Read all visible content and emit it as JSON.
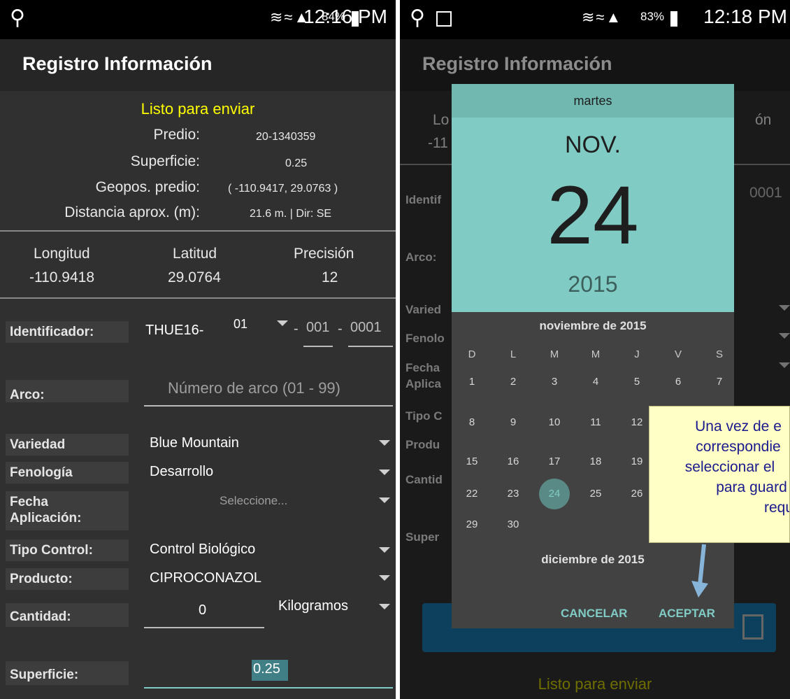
{
  "left": {
    "status": {
      "battery": "84%",
      "time": "12:16 PM"
    },
    "title": "Registro Información",
    "summary": {
      "status_text": "Listo para enviar",
      "rows": [
        {
          "label": "Predio:",
          "value": "20-1340359"
        },
        {
          "label": "Superficie:",
          "value": "0.25"
        },
        {
          "label": "Geopos. predio:",
          "value": "( -110.9417, 29.0763 )"
        },
        {
          "label": "Distancia aprox. (m):",
          "value": "21.6 m. | Dir: SE"
        }
      ]
    },
    "coords": {
      "lon_label": "Longitud",
      "lon": "-110.9418",
      "lat_label": "Latitud",
      "lat": "29.0764",
      "prec_label": "Precisión",
      "prec": "12"
    },
    "form": {
      "identificador": {
        "label": "Identificador:",
        "prefix": "THUE16-",
        "select": "01",
        "sep1": "-",
        "part2": "001",
        "sep2": "-",
        "part3": "0001"
      },
      "arco": {
        "label": "Arco:",
        "placeholder": "Número de arco (01 - 99)"
      },
      "variedad": {
        "label": "Variedad",
        "value": "Blue Mountain"
      },
      "fenologia": {
        "label": "Fenología",
        "value": "Desarrollo"
      },
      "fecha": {
        "label1": "Fecha",
        "label2": "Aplicación:",
        "value": "Seleccione..."
      },
      "tipo_control": {
        "label": "Tipo Control:",
        "value": "Control Biológico"
      },
      "producto": {
        "label": "Producto:",
        "value": "CIPROCONAZOL"
      },
      "cantidad": {
        "label": "Cantidad:",
        "value": "0",
        "unit": "Kilogramos"
      },
      "superficie": {
        "label": "Superficie:",
        "value": "0.25"
      }
    }
  },
  "right": {
    "status": {
      "battery": "83%",
      "time": "12:18 PM"
    },
    "title": "Registro Información",
    "bg_partial": {
      "lo": "Lo",
      "lo_val": "-11",
      "on": "ón",
      "ident": "Identif",
      "ident_val": "0001",
      "arco": "Arco:",
      "varied": "Varied",
      "fenolo": "Fenolo",
      "fecha": "Fecha",
      "aplica": "Aplica",
      "tipo": "Tipo C",
      "produ": "Produ",
      "cantid": "Cantid",
      "super": "Super",
      "footer_status": "Listo para enviar"
    },
    "picker": {
      "day_of_week": "martes",
      "month": "NOV.",
      "day": "24",
      "year": "2015",
      "month_title": "noviembre de 2015",
      "weekdays": [
        "D",
        "L",
        "M",
        "M",
        "J",
        "V",
        "S"
      ],
      "days": [
        "1",
        "2",
        "3",
        "4",
        "5",
        "6",
        "7",
        "8",
        "9",
        "10",
        "11",
        "12",
        "15",
        "16",
        "17",
        "18",
        "19",
        "22",
        "23",
        "24",
        "25",
        "26",
        "29",
        "30"
      ],
      "selected": "24",
      "next_month_title": "diciembre de 2015",
      "cancel": "CANCELAR",
      "accept": "ACEPTAR"
    },
    "tooltip_lines": [
      "Una vez de e",
      "correspondie",
      "seleccionar el",
      "para guard",
      "requ"
    ]
  },
  "colors": {
    "accent": "#80cbc4",
    "status_yellow": "#ffff00",
    "tooltip_bg": "#ffffc6",
    "arrow": "#87b4d9"
  }
}
